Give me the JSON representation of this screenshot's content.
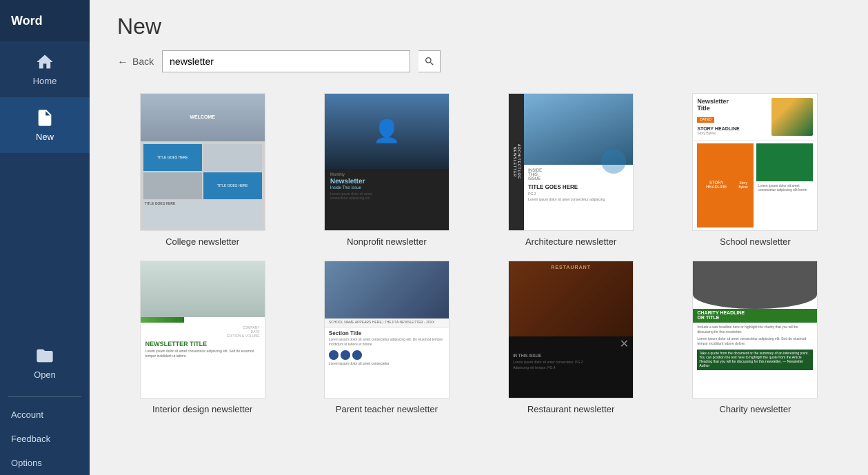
{
  "sidebar": {
    "app_title": "Word",
    "nav_items": [
      {
        "id": "home",
        "label": "Home",
        "icon": "home"
      },
      {
        "id": "new",
        "label": "New",
        "icon": "new-doc",
        "active": true
      }
    ],
    "open_item": {
      "id": "open",
      "label": "Open",
      "icon": "folder"
    },
    "bottom_items": [
      {
        "id": "account",
        "label": "Account"
      },
      {
        "id": "feedback",
        "label": "Feedback"
      },
      {
        "id": "options",
        "label": "Options"
      }
    ]
  },
  "main": {
    "page_title": "New",
    "back_label": "Back",
    "search_placeholder": "newsletter",
    "search_button_label": "Search",
    "templates": [
      {
        "id": "college",
        "label": "College newsletter"
      },
      {
        "id": "nonprofit",
        "label": "Nonprofit newsletter"
      },
      {
        "id": "architecture",
        "label": "Architecture newsletter"
      },
      {
        "id": "school",
        "label": "School newsletter"
      },
      {
        "id": "interior",
        "label": "Interior design newsletter"
      },
      {
        "id": "parent",
        "label": "Parent teacher newsletter"
      },
      {
        "id": "restaurant",
        "label": "Restaurant newsletter"
      },
      {
        "id": "charity",
        "label": "Charity newsletter"
      }
    ]
  }
}
